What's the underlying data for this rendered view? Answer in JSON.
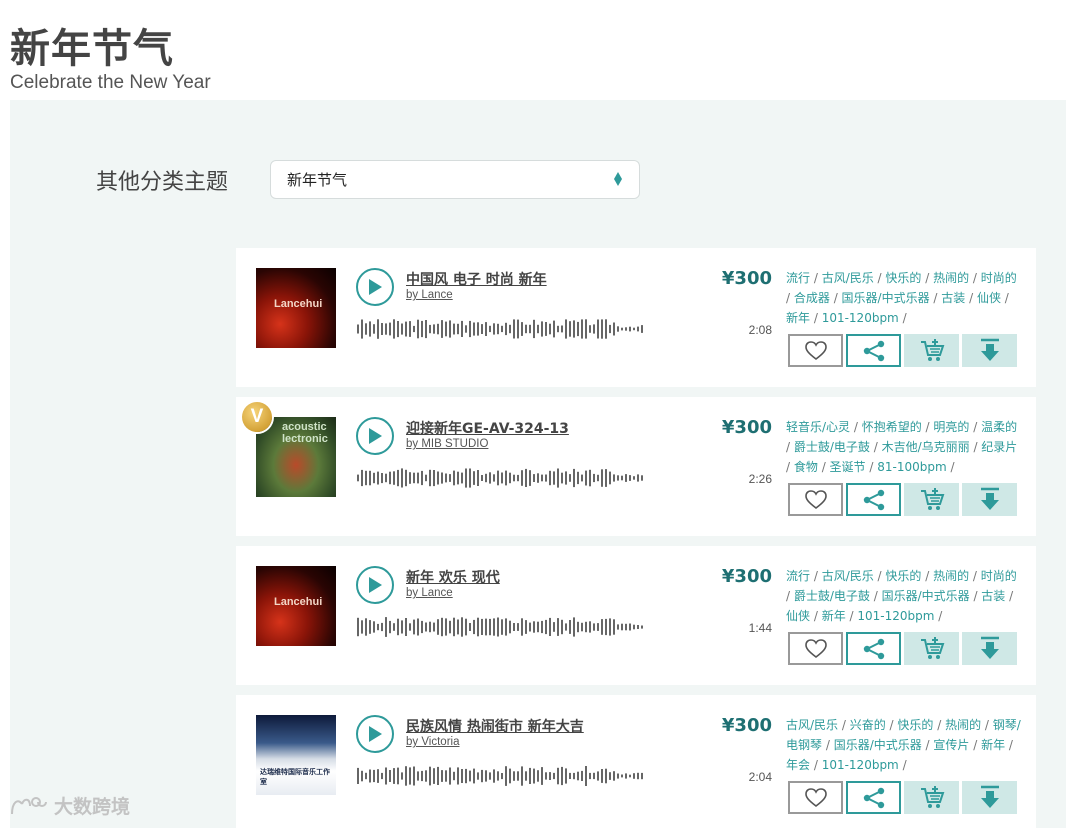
{
  "header": {
    "title": "新年节气",
    "subtitle": "Celebrate the New Year"
  },
  "filter": {
    "label": "其他分类主题",
    "selected": "新年节气"
  },
  "tracks": [
    {
      "title": "中国风 电子 时尚 新年",
      "artist": "by Lance",
      "price": "¥300",
      "duration": "2:08",
      "cover_text": "Lancehui",
      "vip": "",
      "tags": [
        "流行",
        "古风/民乐",
        "快乐的",
        "热闹的",
        "时尚的",
        "合成器",
        "国乐器/中式乐器",
        "古装",
        "仙侠",
        "新年",
        "101-120bpm"
      ]
    },
    {
      "title": "迎接新年GE-AV-324-13",
      "artist": "by MIB STUDIO",
      "price": "¥300",
      "duration": "2:26",
      "cover_text": "acoustic lectronic",
      "vip": "V",
      "tags": [
        "轻音乐/心灵",
        "怀抱希望的",
        "明亮的",
        "温柔的",
        "爵士鼓/电子鼓",
        "木吉他/乌克丽丽",
        "纪录片",
        "食物",
        "圣诞节",
        "81-100bpm"
      ]
    },
    {
      "title": "新年 欢乐 现代",
      "artist": "by Lance",
      "price": "¥300",
      "duration": "1:44",
      "cover_text": "Lancehui",
      "vip": "",
      "tags": [
        "流行",
        "古风/民乐",
        "快乐的",
        "热闹的",
        "时尚的",
        "爵士鼓/电子鼓",
        "国乐器/中式乐器",
        "古装",
        "仙侠",
        "新年",
        "101-120bpm"
      ]
    },
    {
      "title": "民族风情 热闹街市 新年大吉",
      "artist": "by Victoria",
      "price": "¥300",
      "duration": "2:04",
      "cover_text": "达瑞维特国际音乐工作室",
      "vip": "",
      "tags": [
        "古风/民乐",
        "兴奋的",
        "快乐的",
        "热闹的",
        "钢琴/电钢琴",
        "国乐器/中式乐器",
        "宣传片",
        "新年",
        "年会",
        "101-120bpm"
      ]
    }
  ],
  "watermark": {
    "text": "大数跨境"
  },
  "colors": {
    "accent": "#2e9a9a",
    "price": "#1e6f72",
    "panel_bg": "#f1f6f5",
    "button_tint": "#cfe8e6"
  }
}
